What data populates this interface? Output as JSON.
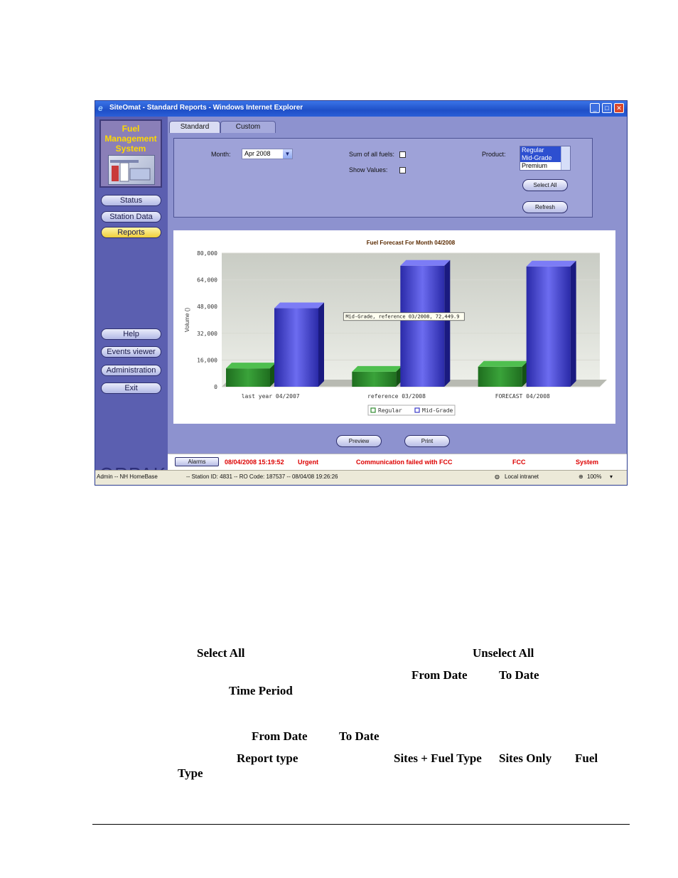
{
  "window": {
    "title": "SiteOmat - Standard Reports - Windows Internet Explorer",
    "controls": {
      "minimize": "_",
      "maximize": "□",
      "close": "✕"
    }
  },
  "logo": {
    "line1": "Fuel",
    "line2": "Management",
    "line3": "System",
    "brand": "ORPAK"
  },
  "nav": {
    "top": [
      {
        "label": "Status"
      },
      {
        "label": "Station Data"
      },
      {
        "label": "Reports"
      }
    ],
    "bottom": [
      {
        "label": "Help"
      },
      {
        "label": "Events viewer"
      },
      {
        "label": "Administration"
      },
      {
        "label": "Exit"
      }
    ]
  },
  "tabs": {
    "standard": "Standard",
    "custom": "Custom"
  },
  "filters": {
    "month_label": "Month:",
    "month_value": "Apr 2008",
    "sum_label": "Sum of all fuels:",
    "show_values_label": "Show Values:",
    "product_label": "Product:",
    "products": [
      "Regular",
      "Mid-Grade",
      "Premium"
    ],
    "select_all": "Select All",
    "refresh": "Refresh"
  },
  "chart_data": {
    "type": "bar",
    "title": "Fuel Forecast For Month 04/2008",
    "ylabel": "Volume ()",
    "xlabel": "",
    "categories": [
      "last year 04/2007",
      "reference 03/2008",
      "FORECAST 04/2008"
    ],
    "series": [
      {
        "name": "Regular",
        "values": [
          11000,
          9000,
          12000
        ],
        "color": "#2e8a2e"
      },
      {
        "name": "Mid-Grade",
        "values": [
          47000,
          72449.9,
          72000
        ],
        "color": "#3a3ac8"
      }
    ],
    "ylim": [
      0,
      80000
    ],
    "yticks": [
      "80,000",
      "64,000",
      "48,000",
      "32,000",
      "16,000",
      "0"
    ],
    "tooltip": "Mid-Grade, reference 03/2008, 72,449.9",
    "legend_position": "bottom"
  },
  "actions": {
    "preview": "Preview",
    "print": "Print"
  },
  "alarm_row": {
    "button": "Alarms",
    "datetime": "08/04/2008 15:19:52",
    "level": "Urgent",
    "message": "Communication failed with FCC",
    "source": "FCC",
    "type": "System"
  },
  "ie_status": {
    "user": "Admin -- NH HomeBase",
    "station": "-- Station ID: 4831 -- RO Code: 187537 -- 08/04/08  19:26:26",
    "zone": "Local intranet",
    "zoom": "100%"
  },
  "doc": {
    "line1_a": "Select All",
    "line1_b": "Unselect All",
    "line2_a": "From Date",
    "line2_b": "To Date",
    "line3": "Time Period",
    "line4_a": "From Date",
    "line4_b": "To Date",
    "line5_a": "Report type",
    "line5_b": "Sites + Fuel Type",
    "line5_c": "Sites Only",
    "line5_d": "Fuel",
    "line6": "Type"
  },
  "colors": {
    "accent_red": "#dd0000",
    "nav_bg": "#5b5fb0",
    "active_nav": "#f0cf3a"
  }
}
